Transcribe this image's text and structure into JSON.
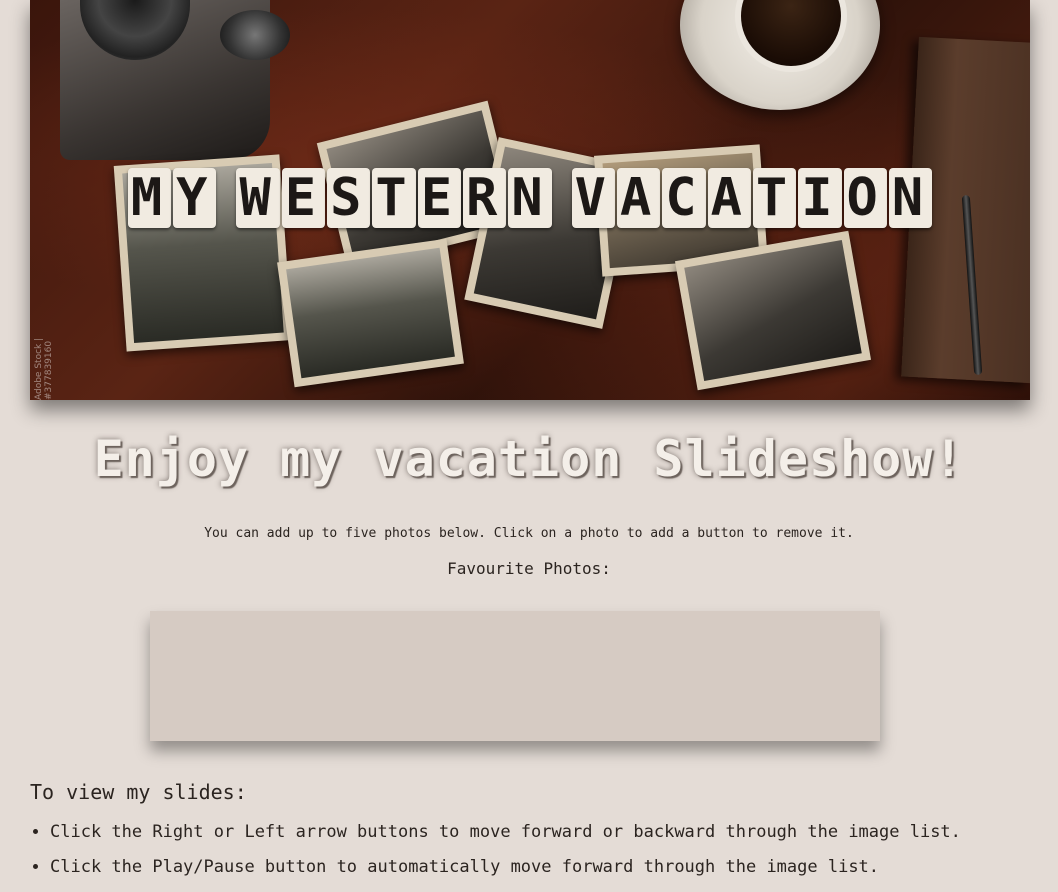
{
  "banner": {
    "title_words": [
      "MY",
      "WESTERN",
      "VACATION"
    ],
    "watermark": "Adobe Stock | #377839160"
  },
  "heading": "Enjoy my vacation Slideshow!",
  "intro": "You can add up to five photos below. Click on a photo to add a button to remove it.",
  "favourites": {
    "label": "Favourite Photos:"
  },
  "instructions": {
    "title": "To view my slides:",
    "items": [
      "Click the Right or Left arrow buttons to move forward or backward through the image list.",
      "Click the Play/Pause button to automatically move forward through the image list."
    ]
  },
  "colors": {
    "background": "#e4dcd6",
    "favourites_box": "#d6cbc3",
    "text": "#2b2420"
  }
}
